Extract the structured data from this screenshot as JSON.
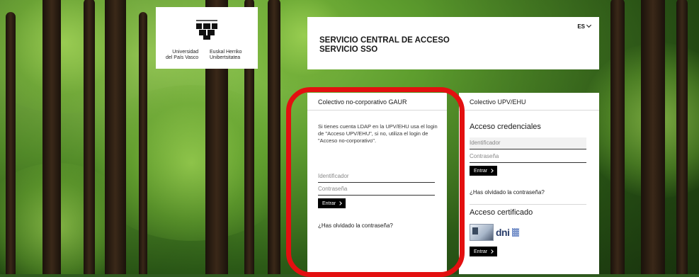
{
  "logo": {
    "es_line1": "Universidad",
    "es_line2": "del País Vasco",
    "eu_line1": "Euskal Herriko",
    "eu_line2": "Unibertsitatea",
    "icon": "upv-ehu-logo-icon"
  },
  "header": {
    "title_line1": "SERVICIO CENTRAL DE ACCESO",
    "title_line2": "SERVICIO SSO",
    "lang": "ES",
    "lang_icon": "chevron-down-icon"
  },
  "gaur": {
    "heading": "Colectivo no-corporativo GAUR",
    "description": "Si tienes cuenta LDAP en la UPV/EHU usa el login de \"Acceso UPV/EHU\", si no, utiliza el login de \"Acceso no-corporativo\".",
    "username_placeholder": "Identificador",
    "password_placeholder": "Contraseña",
    "submit_label": "Entrar",
    "forgot_link": "¿Has olvidado la contraseña?"
  },
  "upv": {
    "heading": "Colectivo UPV/EHU",
    "credentials_title": "Acceso credenciales",
    "username_placeholder": "Identificador",
    "password_placeholder": "Contraseña",
    "submit_label": "Entrar",
    "forgot_link": "¿Has olvidado la contraseña?",
    "certificate_title": "Acceso certificado",
    "dni_label": "dni",
    "certificate_submit_label": "Entrar"
  },
  "colors": {
    "highlight": "#e31010",
    "button_bg": "#000000",
    "panel_bg": "#ffffff"
  }
}
